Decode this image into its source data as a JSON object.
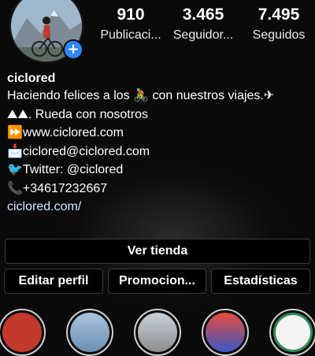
{
  "profile": {
    "username": "ciclored",
    "add_icon": "+"
  },
  "stats": {
    "posts": {
      "value": "910",
      "label": "Publicaci..."
    },
    "followers": {
      "value": "3.465",
      "label": "Seguidor..."
    },
    "following": {
      "value": "7.495",
      "label": "Seguidos"
    }
  },
  "bio": {
    "line1": "Haciendo felices a los 🚴 con nuestros viajes.✈",
    "line2": "⛰⛰. Rueda con nosotros",
    "line3": "⏩www.ciclored.com",
    "line4": "📩ciclored@ciclored.com",
    "line5": "🐦Twitter: @ciclored",
    "line6": "📞+34617232667",
    "link": "ciclored.com/"
  },
  "buttons": {
    "shop": "Ver tienda",
    "edit": "Editar perfil",
    "promo": "Promocion...",
    "stats": "Estadísticas"
  },
  "highlights": [
    {
      "icon": "highlight-red-icon",
      "color": "#c0392b"
    },
    {
      "icon": "highlight-mountain-icon",
      "color": "#6b8fb3"
    },
    {
      "icon": "highlight-town-icon",
      "color": "#8c8c8c"
    },
    {
      "icon": "highlight-event-icon",
      "color": "#3b57c4"
    },
    {
      "icon": "highlight-campus-icon",
      "color": "#2e8b57"
    }
  ]
}
